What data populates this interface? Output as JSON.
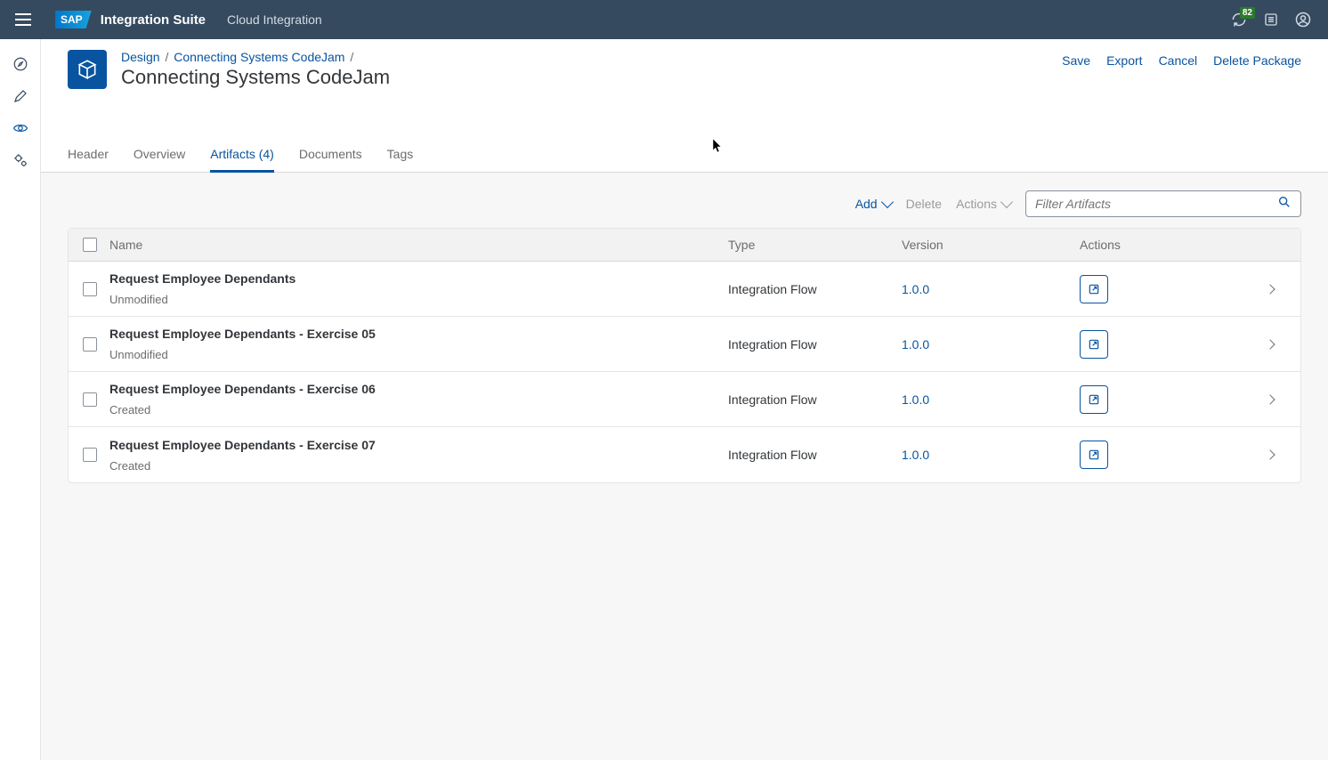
{
  "shell": {
    "sapLogo": "SAP",
    "suite": "Integration Suite",
    "sub": "Cloud Integration",
    "notificationCount": "82"
  },
  "breadcrumb": {
    "root": "Design",
    "current": "Connecting Systems CodeJam",
    "sep": "/"
  },
  "pageTitle": "Connecting Systems CodeJam",
  "pageActions": {
    "save": "Save",
    "export": "Export",
    "cancel": "Cancel",
    "deletePackage": "Delete Package"
  },
  "tabs": [
    {
      "label": "Header",
      "active": false
    },
    {
      "label": "Overview",
      "active": false
    },
    {
      "label": "Artifacts (4)",
      "active": true
    },
    {
      "label": "Documents",
      "active": false
    },
    {
      "label": "Tags",
      "active": false
    }
  ],
  "toolbar": {
    "add": "Add",
    "delete": "Delete",
    "actions": "Actions",
    "filterPlaceholder": "Filter Artifacts"
  },
  "columns": {
    "name": "Name",
    "type": "Type",
    "version": "Version",
    "actions": "Actions"
  },
  "rows": [
    {
      "name": "Request Employee Dependants",
      "status": "Unmodified",
      "type": "Integration Flow",
      "version": "1.0.0"
    },
    {
      "name": "Request Employee Dependants - Exercise 05",
      "status": "Unmodified",
      "type": "Integration Flow",
      "version": "1.0.0"
    },
    {
      "name": "Request Employee Dependants - Exercise 06",
      "status": "Created",
      "type": "Integration Flow",
      "version": "1.0.0"
    },
    {
      "name": "Request Employee Dependants - Exercise 07",
      "status": "Created",
      "type": "Integration Flow",
      "version": "1.0.0"
    }
  ]
}
